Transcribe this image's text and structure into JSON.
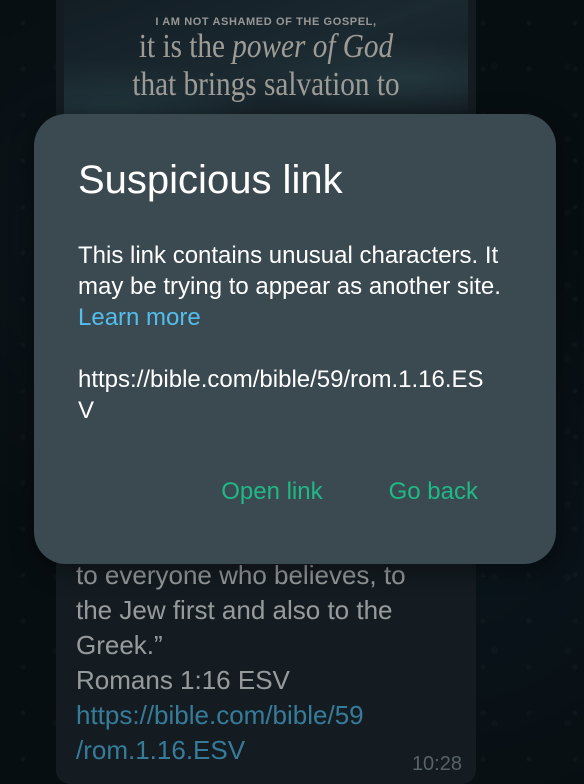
{
  "message": {
    "image": {
      "line_small": "I AM NOT ASHAMED OF THE GOSPEL,",
      "line_1_a": "it is the ",
      "line_1_b": "power of God",
      "line_2": "that brings salvation to"
    },
    "text_lines": [
      "to everyone who believes, to",
      "the Jew first and also to the",
      "Greek.”",
      "Romans 1:16 ESV"
    ],
    "link_line_1": "https://bible.com/bible/59",
    "link_line_2": "/rom.1.16.ESV",
    "time": "10:28"
  },
  "dialog": {
    "title": "Suspicious link",
    "message": "This link contains unusual characters. It may be trying to appear as another site.",
    "learn_more": "Learn more",
    "url": "https://bible.com/bible/59/rom.1.16.ESV",
    "open_link": "Open link",
    "go_back": "Go back"
  },
  "colors": {
    "accent_green": "#1fb887",
    "link_blue": "#53bdeb",
    "dialog_bg": "#3b4a51",
    "bubble_bg": "#1f2c33"
  }
}
